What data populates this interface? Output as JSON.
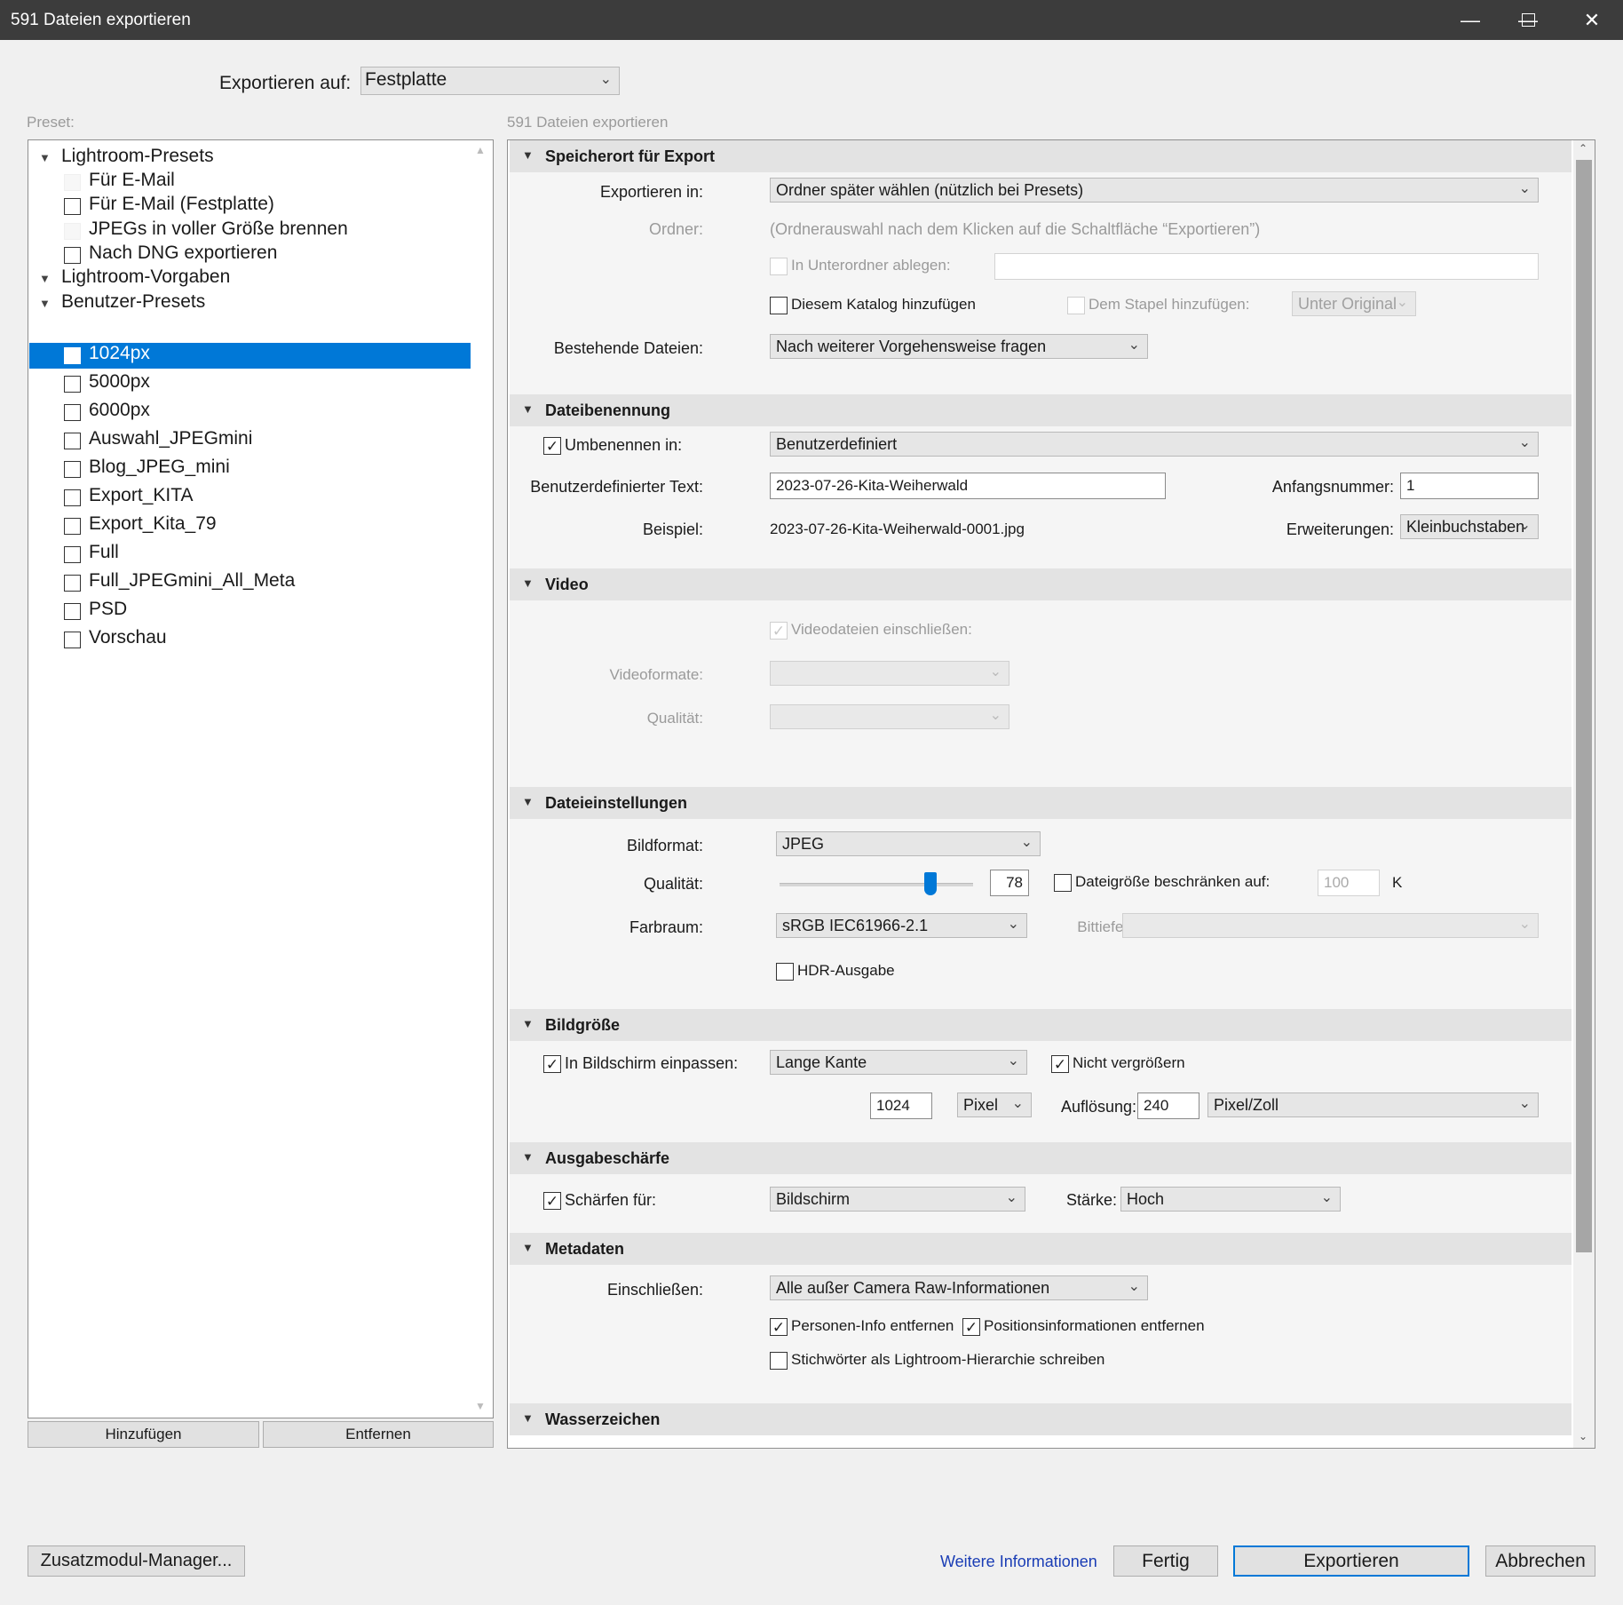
{
  "window": {
    "title": "591 Dateien exportieren"
  },
  "export_to": {
    "label": "Exportieren auf:",
    "value": "Festplatte"
  },
  "preset": {
    "label": "Preset:",
    "groups": [
      {
        "name": "Lightroom-Presets",
        "items": [
          "Für E-Mail",
          "Für E-Mail (Festplatte)",
          "JPEGs in voller Größe brennen",
          "Nach DNG exportieren"
        ]
      },
      {
        "name": "Lightroom-Vorgaben",
        "items": []
      },
      {
        "name": "Benutzer-Presets",
        "items": [
          "1024px",
          "5000px",
          "6000px",
          "Auswahl_JPEGmini",
          "Blog_JPEG_mini",
          "Export_KITA",
          "Export_Kita_79",
          "Full",
          "Full_JPEGmini_All_Meta",
          "PSD",
          "Vorschau"
        ]
      }
    ],
    "selected": "1024px",
    "add_label": "Hinzufügen",
    "remove_label": "Entfernen"
  },
  "settings_title": "591 Dateien exportieren",
  "sections": {
    "location": {
      "title": "Speicherort für Export",
      "export_in_label": "Exportieren in:",
      "export_in_value": "Ordner später wählen (nützlich bei Presets)",
      "folder_label": "Ordner:",
      "folder_value": "(Ordnerauswahl nach dem Klicken auf die Schaltfläche “Exportieren”)",
      "subfolder_label": "In Unterordner ablegen:",
      "subfolder_value": "",
      "add_catalog_label": "Diesem Katalog hinzufügen",
      "add_stack_label": "Dem Stapel hinzufügen:",
      "stack_value": "Unter Original",
      "existing_label": "Bestehende Dateien:",
      "existing_value": "Nach weiterer Vorgehensweise fragen"
    },
    "naming": {
      "title": "Dateibenennung",
      "rename_label": "Umbenennen in:",
      "rename_value": "Benutzerdefiniert",
      "rename_checked": true,
      "custom_text_label": "Benutzerdefinierter Text:",
      "custom_text_value": "2023-07-26-Kita-Weiherwald",
      "start_number_label": "Anfangsnummer:",
      "start_number_value": "1",
      "example_label": "Beispiel:",
      "example_value": "2023-07-26-Kita-Weiherwald-0001.jpg",
      "extensions_label": "Erweiterungen:",
      "extensions_value": "Kleinbuchstaben"
    },
    "video": {
      "title": "Video",
      "include_label": "Videodateien einschließen:",
      "formats_label": "Videoformate:",
      "quality_label": "Qualität:"
    },
    "file": {
      "title": "Dateieinstellungen",
      "format_label": "Bildformat:",
      "format_value": "JPEG",
      "quality_label": "Qualität:",
      "quality_value": "78",
      "quality_fraction": 0.78,
      "limit_label": "Dateigröße beschränken auf:",
      "limit_value": "100",
      "limit_unit": "K",
      "colorspace_label": "Farbraum:",
      "colorspace_value": "sRGB IEC61966-2.1",
      "bitdepth_label": "Bittiefe:",
      "hdr_label": "HDR-Ausgabe"
    },
    "size": {
      "title": "Bildgröße",
      "fit_label": "In Bildschirm einpassen:",
      "fit_value": "Lange Kante",
      "no_enlarge_label": "Nicht vergrößern",
      "size_value": "1024",
      "unit_value": "Pixel",
      "resolution_label": "Auflösung:",
      "resolution_value": "240",
      "resolution_unit": "Pixel/Zoll"
    },
    "sharpen": {
      "title": "Ausgabeschärfe",
      "for_label": "Schärfen für:",
      "for_value": "Bildschirm",
      "amount_label": "Stärke:",
      "amount_value": "Hoch"
    },
    "metadata": {
      "title": "Metadaten",
      "include_label": "Einschließen:",
      "include_value": "Alle außer Camera Raw-Informationen",
      "remove_person_label": "Personen-Info entfernen",
      "remove_location_label": "Positionsinformationen entfernen",
      "keywords_label": "Stichwörter als Lightroom-Hierarchie schreiben"
    },
    "watermark": {
      "title": "Wasserzeichen"
    }
  },
  "footer": {
    "plugin_manager": "Zusatzmodul-Manager...",
    "more_info": "Weitere Informationen",
    "done": "Fertig",
    "export": "Exportieren",
    "cancel": "Abbrechen"
  },
  "colors": {
    "selection": "#0078d7",
    "link": "#1a3db5",
    "titlebar": "#3c3c3c"
  }
}
